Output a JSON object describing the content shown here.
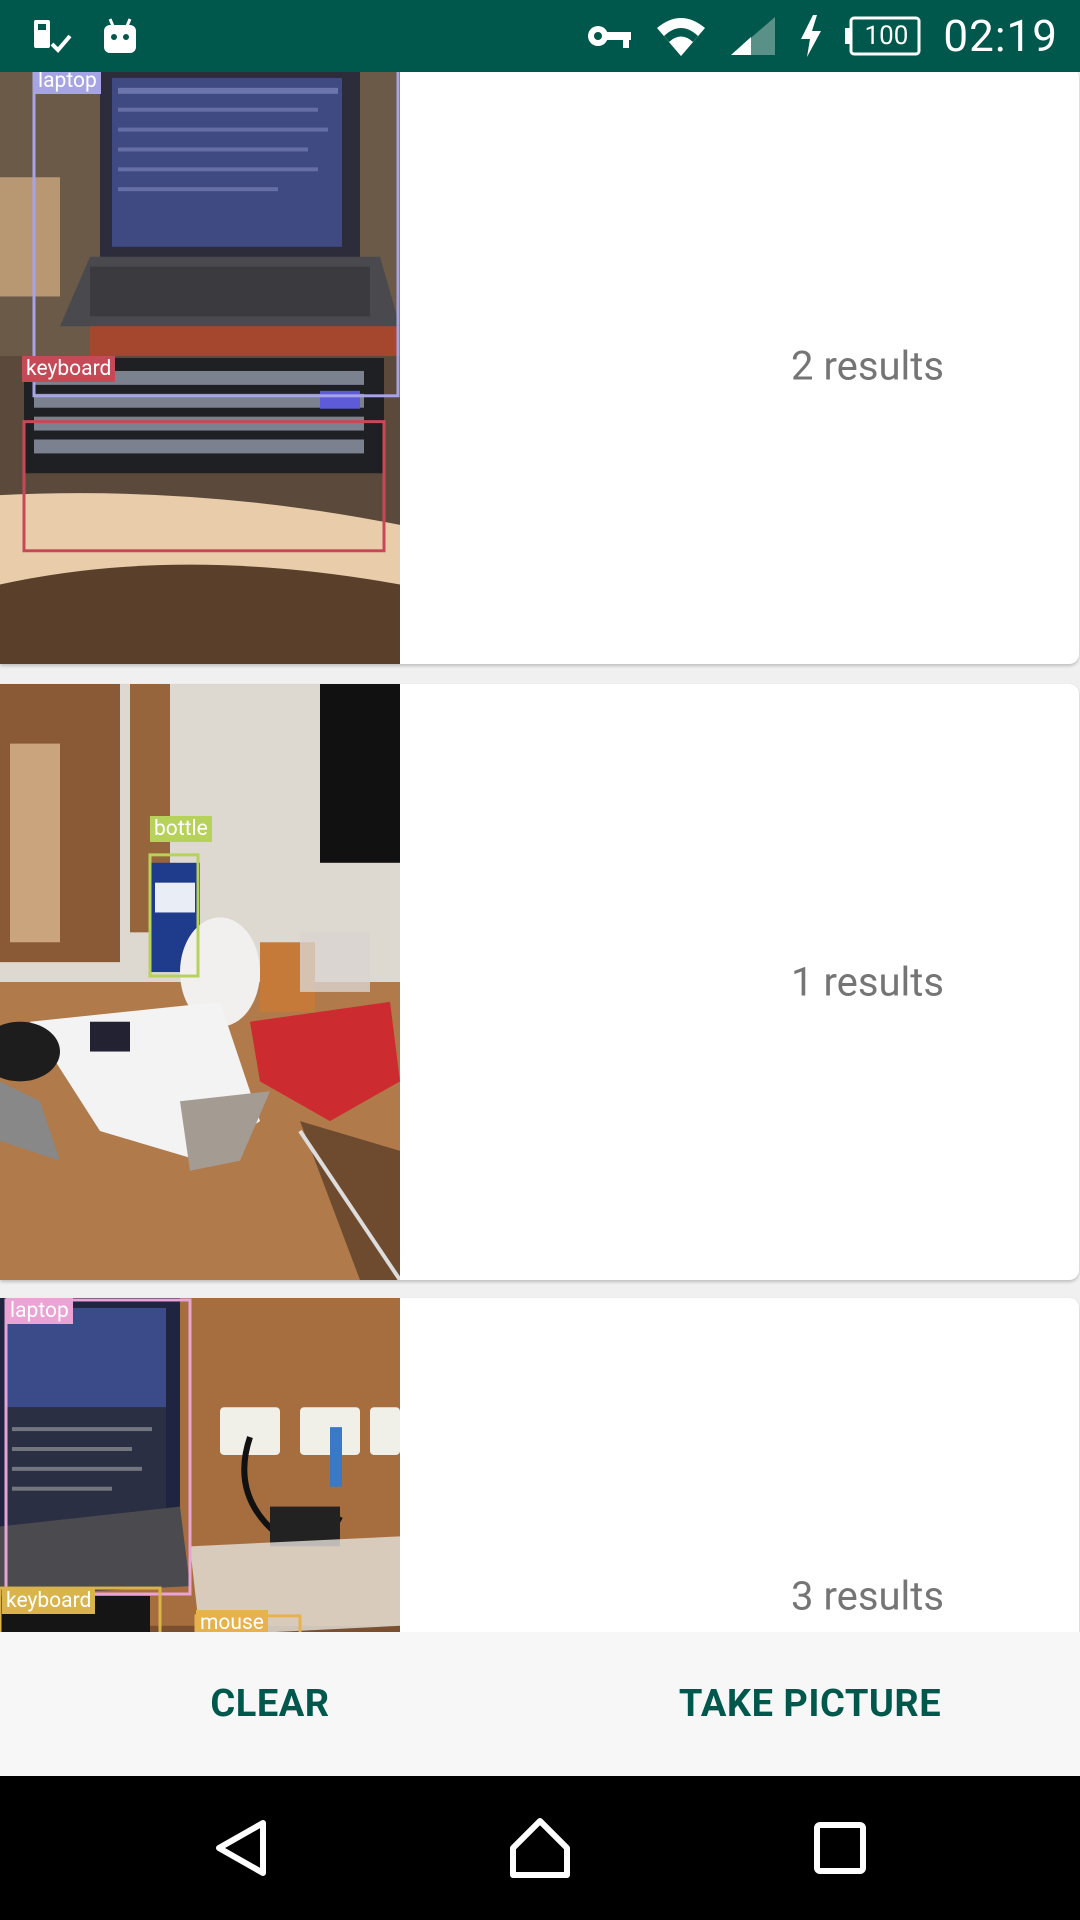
{
  "status_bar": {
    "time": "02:19",
    "battery": "100",
    "icons": [
      "sim-storage-icon",
      "android-icon",
      "vpn-key-icon",
      "wifi-icon",
      "cell-signal-icon",
      "charging-icon",
      "battery-icon"
    ]
  },
  "results": [
    {
      "text": "2 results",
      "labels": [
        "laptop",
        "keyboard"
      ],
      "label_colors": [
        "#a7a4e6",
        "#c44a57"
      ]
    },
    {
      "text": "1 results",
      "labels": [
        "bottle"
      ],
      "label_colors": [
        "#b6d25a"
      ]
    },
    {
      "text": "3 results",
      "labels": [
        "laptop",
        "keyboard",
        "mouse"
      ],
      "label_colors": [
        "#e9a3d4",
        "#d9b34b",
        "#e7b24c"
      ]
    }
  ],
  "actions": {
    "clear_label": "CLEAR",
    "take_picture_label": "TAKE PICTURE"
  },
  "colors": {
    "primary_dark": "#00574B",
    "accent_text": "#00574B",
    "result_text": "#757575"
  }
}
